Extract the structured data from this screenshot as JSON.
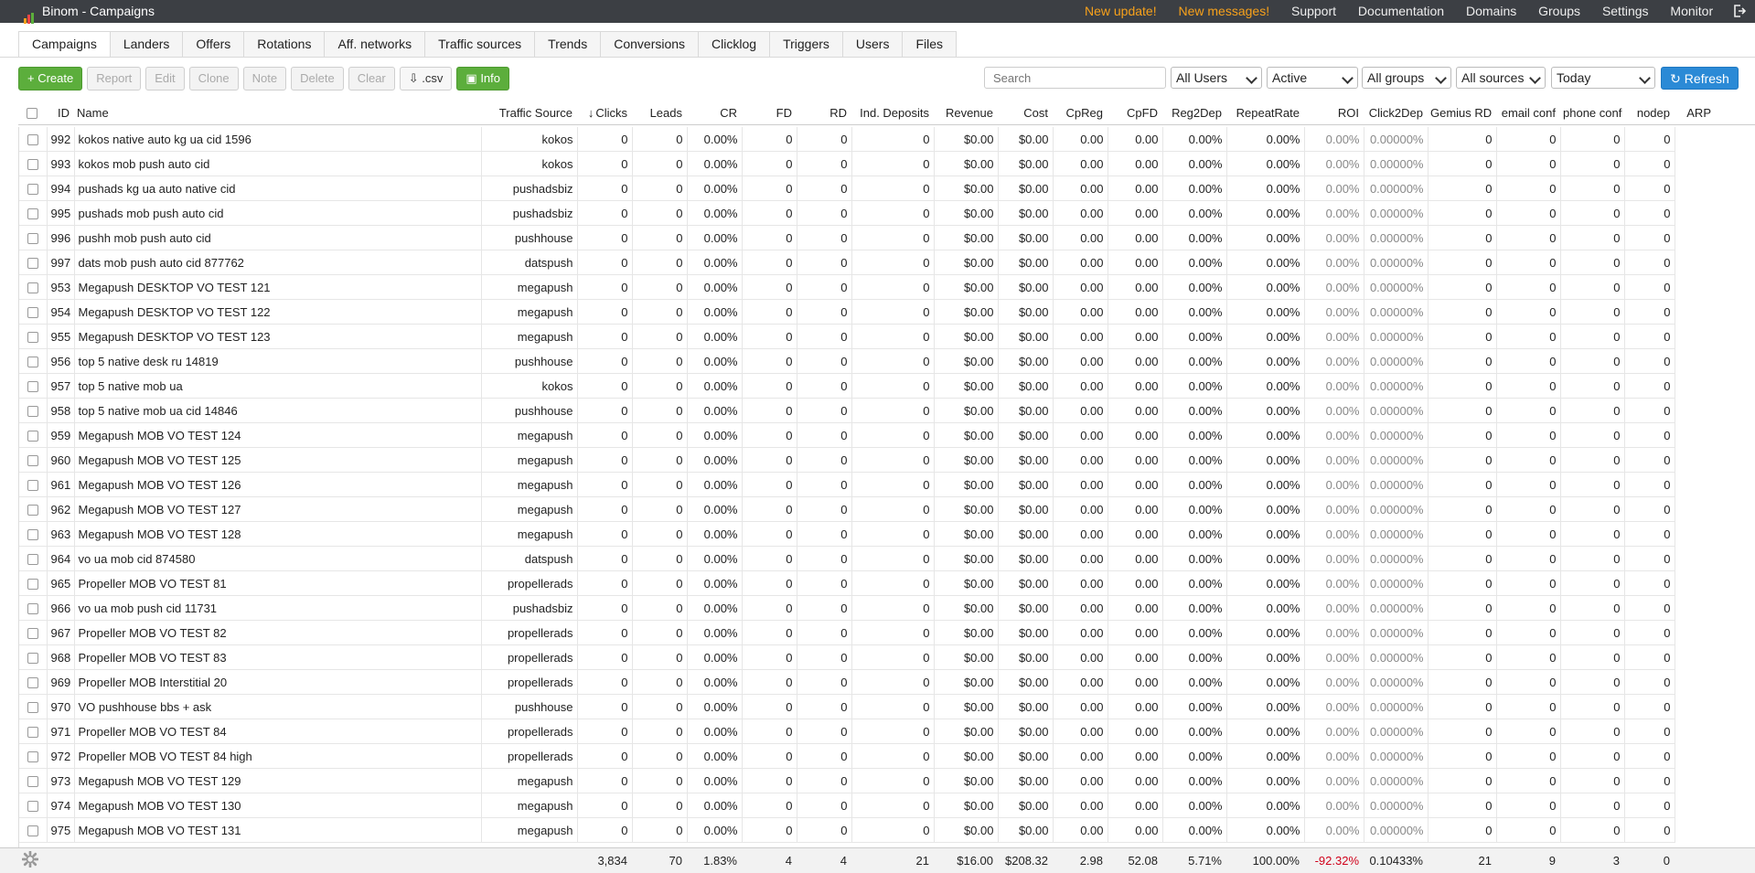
{
  "window_title": "Binom - Campaigns",
  "topnav": {
    "new_update": "New update!",
    "new_messages": "New messages!",
    "support": "Support",
    "documentation": "Documentation",
    "domains": "Domains",
    "groups": "Groups",
    "settings": "Settings",
    "monitor": "Monitor"
  },
  "tabs": [
    "Campaigns",
    "Landers",
    "Offers",
    "Rotations",
    "Aff. networks",
    "Traffic sources",
    "Trends",
    "Conversions",
    "Clicklog",
    "Triggers",
    "Users",
    "Files"
  ],
  "toolbar": {
    "create": "+ Create",
    "report": "Report",
    "edit": "Edit",
    "clone": "Clone",
    "note": "Note",
    "delete": "Delete",
    "clear": "Clear",
    "csv": ".csv",
    "info": "Info"
  },
  "filters": {
    "search_placeholder": "Search",
    "users": "All Users",
    "status": "Active",
    "groups": "All groups",
    "sources": "All sources",
    "period": "Today",
    "refresh": "Refresh"
  },
  "columns": [
    "ID",
    "Name",
    "Traffic Source",
    "Clicks",
    "Leads",
    "CR",
    "FD",
    "RD",
    "Ind. Deposits",
    "Revenue",
    "Cost",
    "CpReg",
    "CpFD",
    "Reg2Dep",
    "RepeatRate",
    "ROI",
    "Click2Dep",
    "Gemius RD",
    "email conf",
    "phone conf",
    "nodep",
    "ARP"
  ],
  "rows": [
    [
      "992",
      "kokos native auto kg ua cid 1596",
      "kokos"
    ],
    [
      "993",
      "kokos mob push auto cid",
      "kokos"
    ],
    [
      "994",
      "pushads kg ua auto native cid",
      "pushadsbiz"
    ],
    [
      "995",
      "pushads mob push auto cid",
      "pushadsbiz"
    ],
    [
      "996",
      "pushh mob push auto cid",
      "pushhouse"
    ],
    [
      "997",
      "dats mob push auto cid 877762",
      "datspush"
    ],
    [
      "953",
      "Megapush DESKTOP VO TEST 121",
      "megapush"
    ],
    [
      "954",
      "Megapush DESKTOP VO TEST 122",
      "megapush"
    ],
    [
      "955",
      "Megapush DESKTOP VO TEST 123",
      "megapush"
    ],
    [
      "956",
      "top 5 native desk ru 14819",
      "pushhouse"
    ],
    [
      "957",
      "top 5 native mob ua",
      "kokos"
    ],
    [
      "958",
      "top 5 native mob ua cid 14846",
      "pushhouse"
    ],
    [
      "959",
      "Megapush MOB VO TEST 124",
      "megapush"
    ],
    [
      "960",
      "Megapush MOB VO TEST 125",
      "megapush"
    ],
    [
      "961",
      "Megapush MOB VO TEST 126",
      "megapush"
    ],
    [
      "962",
      "Megapush MOB VO TEST 127",
      "megapush"
    ],
    [
      "963",
      "Megapush MOB VO TEST 128",
      "megapush"
    ],
    [
      "964",
      "vo ua mob cid 874580",
      "datspush"
    ],
    [
      "965",
      "Propeller MOB VO TEST 81",
      "propellerads"
    ],
    [
      "966",
      "vo ua mob push cid 11731",
      "pushadsbiz"
    ],
    [
      "967",
      "Propeller MOB VO TEST 82",
      "propellerads"
    ],
    [
      "968",
      "Propeller MOB VO TEST 83",
      "propellerads"
    ],
    [
      "969",
      "Propeller MOB Interstitial 20",
      "propellerads"
    ],
    [
      "970",
      "VO pushhouse bbs + ask",
      "pushhouse"
    ],
    [
      "971",
      "Propeller MOB VO TEST 84",
      "propellerads"
    ],
    [
      "972",
      "Propeller MOB VO TEST 84 high",
      "propellerads"
    ],
    [
      "973",
      "Megapush MOB VO TEST 129",
      "megapush"
    ],
    [
      "974",
      "Megapush MOB VO TEST 130",
      "megapush"
    ],
    [
      "975",
      "Megapush MOB VO TEST 131",
      "megapush"
    ]
  ],
  "row_values": [
    "0",
    "0",
    "0.00%",
    "0",
    "0",
    "0",
    "$0.00",
    "$0.00",
    "0.00",
    "0.00",
    "0.00%",
    "0.00%",
    "0.00%",
    "0.00000%",
    "0",
    "0",
    "0",
    "0"
  ],
  "totals": [
    "3,834",
    "70",
    "1.83%",
    "4",
    "4",
    "21",
    "$16.00",
    "$208.32",
    "2.98",
    "52.08",
    "5.71%",
    "100.00%",
    "-92.32%",
    "0.10433%",
    "21",
    "9",
    "3",
    "0"
  ],
  "colors": {
    "topbar": "#3c3f44",
    "accent_orange": "#f7a11b",
    "green": "#5cae3c",
    "blue": "#2b8ad6",
    "negative": "#d0021b"
  }
}
